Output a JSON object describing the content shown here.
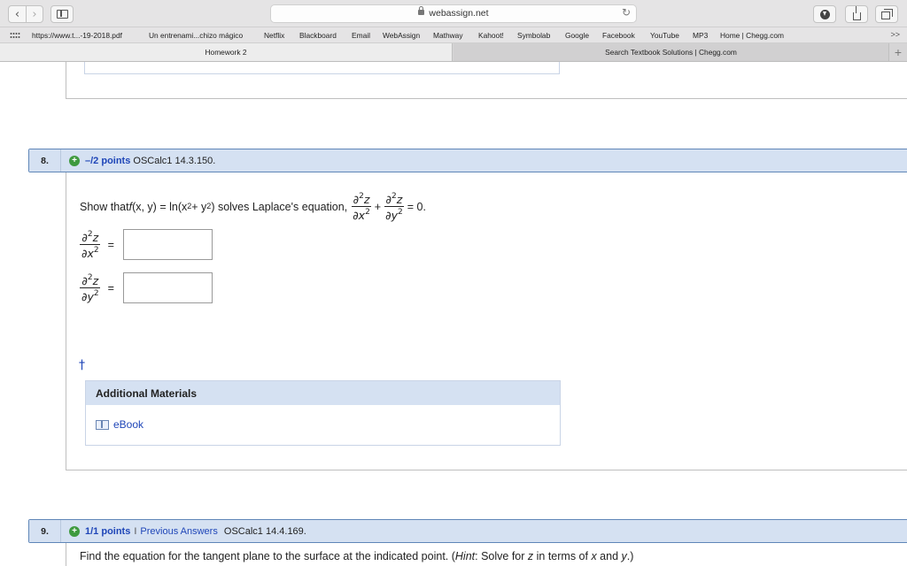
{
  "browser": {
    "url": "webassign.net",
    "bookmarks": [
      "https://www.t...-19-2018.pdf",
      "Un entrenami...chizo mágico",
      "Netflix",
      "Blackboard",
      "Email",
      "WebAssign",
      "Mathway",
      "Kahoot!",
      "Symbolab",
      "Google",
      "Facebook",
      "YouTube",
      "MP3",
      "Home | Chegg.com"
    ],
    "bookmarks_more": ">>",
    "tabs": [
      {
        "label": "Homework 2",
        "active": true
      },
      {
        "label": "Search Textbook Solutions | Chegg.com",
        "active": false
      }
    ],
    "new_tab": "+"
  },
  "q8": {
    "number": "8.",
    "points": "–/2 points",
    "source": "OSCalc1 14.3.150.",
    "statement_prefix": "Show that ",
    "statement_f": "f",
    "statement_args": "(x, y) = ln(x",
    "statement_mid": " + y",
    "statement_end": ") solves Laplace's equation,",
    "frac_num": "∂",
    "eq_zero": "= 0.",
    "plus": "+",
    "equals": "=",
    "dagger": "†",
    "materials_title": "Additional Materials",
    "ebook_label": "eBook",
    "answers": [
      {
        "label": "d2z/dx2",
        "value": ""
      },
      {
        "label": "d2z/dy2",
        "value": ""
      }
    ]
  },
  "q9": {
    "number": "9.",
    "points": "1/1 points",
    "separator": "I",
    "previous_answers": "Previous Answers",
    "source": "OSCalc1 14.4.169.",
    "statement_a": "Find the equation for the tangent plane to the surface at the indicated point. (",
    "hint": "Hint",
    "statement_b": ": Solve for ",
    "z": "z",
    "statement_c": " in terms of ",
    "x": "x",
    "statement_d": " and ",
    "y": "y",
    "statement_e": ".)"
  }
}
